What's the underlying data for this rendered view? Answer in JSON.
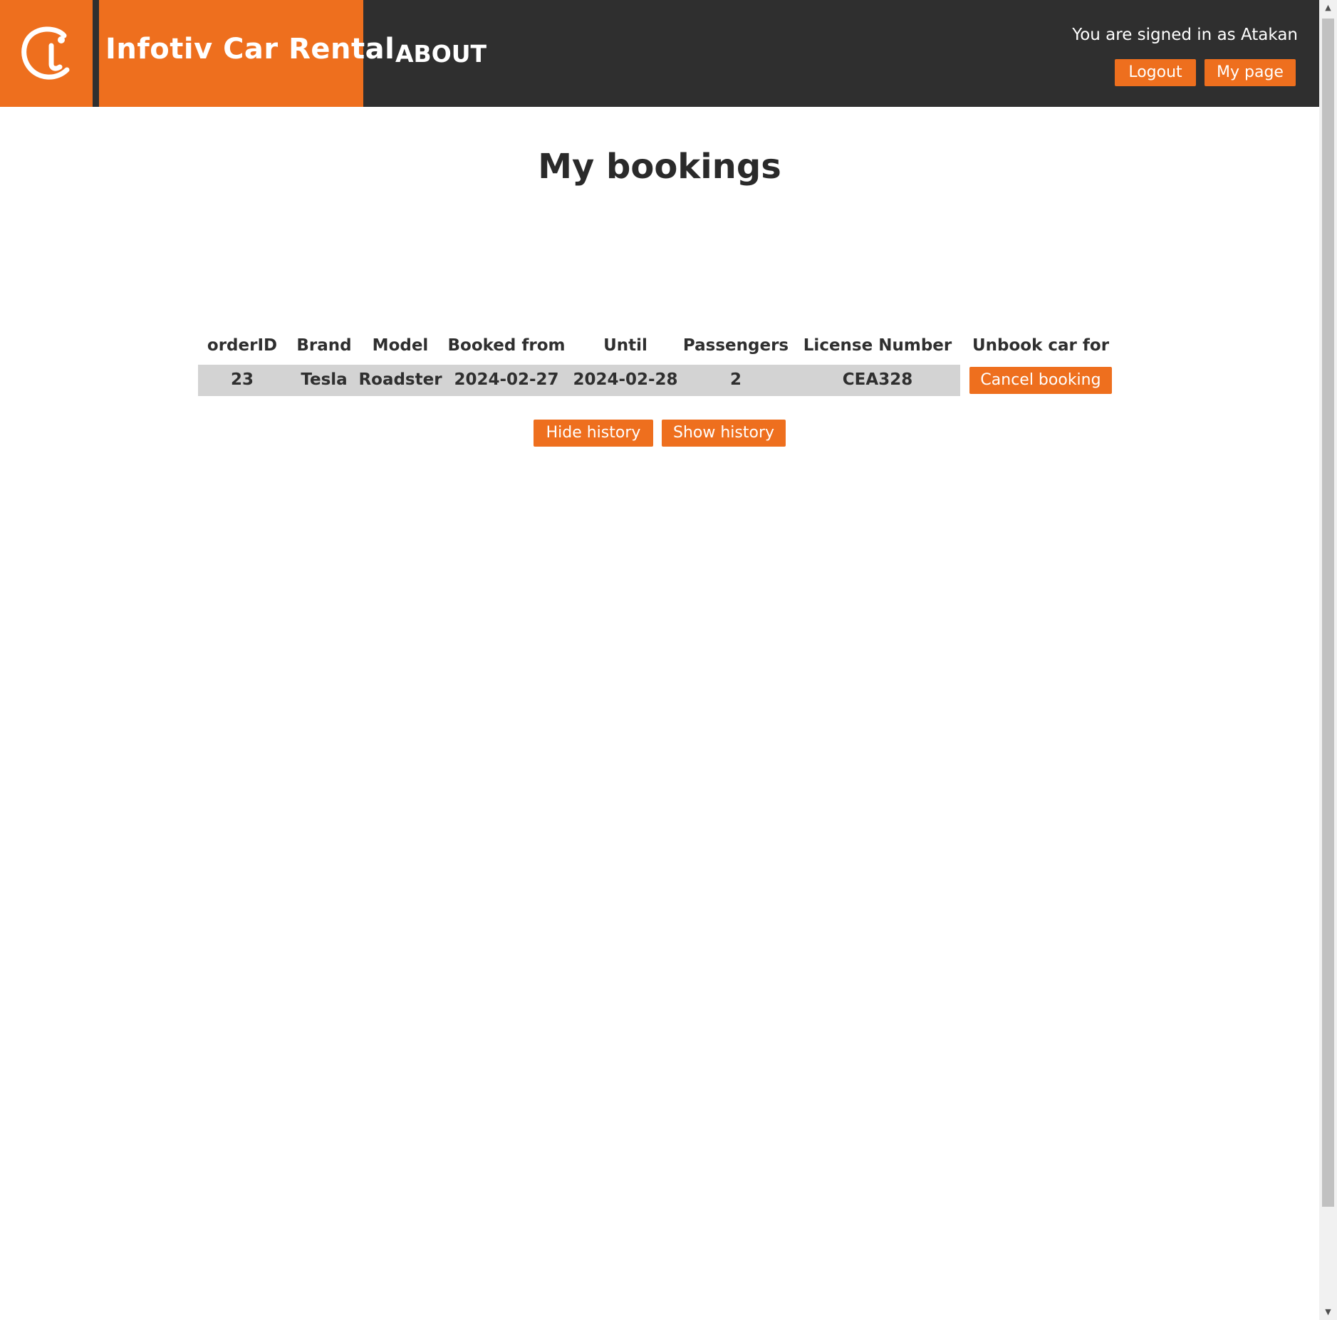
{
  "header": {
    "site_title": "Infotiv Car Rental",
    "nav_about": "ABOUT",
    "signed_in_text": "You are signed in as Atakan",
    "logout_label": "Logout",
    "mypage_label": "My page"
  },
  "main": {
    "heading": "My bookings",
    "table": {
      "headers": [
        "orderID",
        "Brand",
        "Model",
        "Booked from",
        "Until",
        "Passengers",
        "License Number",
        "Unbook car for"
      ],
      "rows": [
        {
          "orderID": "23",
          "brand": "Tesla",
          "model": "Roadster",
          "booked_from": "2024-02-27",
          "until": "2024-02-28",
          "passengers": "2",
          "license_number": "CEA328",
          "action_label": "Cancel booking"
        }
      ]
    },
    "hide_history_label": "Hide history",
    "show_history_label": "Show history"
  },
  "colors": {
    "brand_orange": "#ee6f1e",
    "header_dark": "#2f2f2f",
    "row_gray": "#d3d3d3"
  }
}
